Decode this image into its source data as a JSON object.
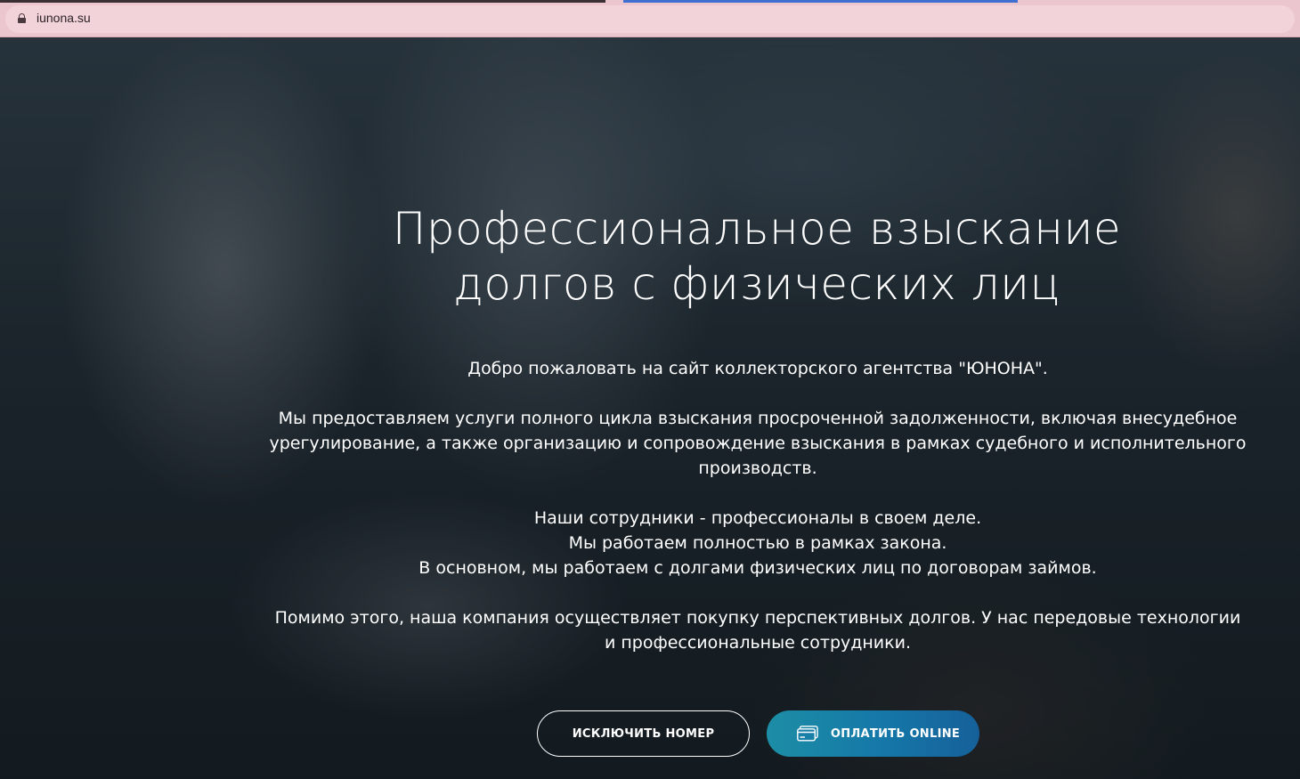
{
  "browser": {
    "url": "iunona.su"
  },
  "hero": {
    "title_lines": [
      "Профессиональное взыскание",
      "долгов с физических лиц"
    ],
    "paragraphs": [
      [
        "Добро пожаловать на сайт коллекторского агентства \"ЮНОНА\"."
      ],
      [
        "Мы предоставляем услуги полного цикла взыскания просроченной задолженности, включая внесудебное урегулирование, а также организацию и сопровождение взыскания в рамках судебного и исполнительного производств."
      ],
      [
        "Наши сотрудники - профессионалы в своем деле.",
        "Мы работаем полностью в рамках закона.",
        "В основном, мы работаем с долгами физических лиц по договорам займов."
      ],
      [
        "Помимо этого, наша компания осуществляет покупку перспективных долгов. У нас передовые технологии и профессиональные сотрудники."
      ]
    ],
    "buttons": {
      "exclude_label": "ИСКЛЮЧИТЬ НОМЕР",
      "pay_label": "ОПЛАТИТЬ ONLINE",
      "pay_icon": "credit-card-icon"
    }
  },
  "colors": {
    "address_bar": "#ecc6cf",
    "pay_button_start": "#1d8ea6",
    "pay_button_end": "#16609a",
    "text": "#ffffff"
  }
}
